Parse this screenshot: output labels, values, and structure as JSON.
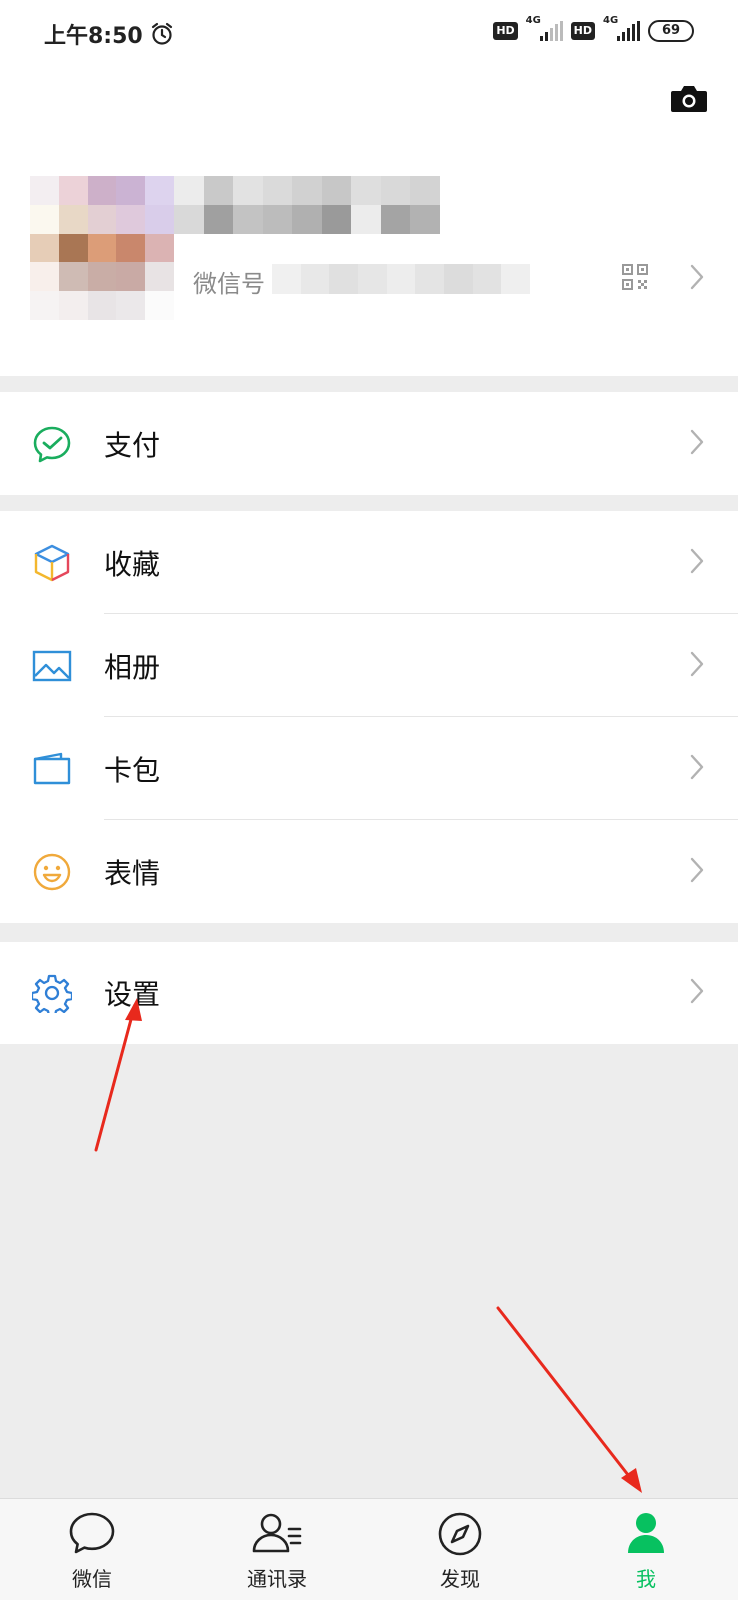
{
  "status_bar": {
    "time": "上午8:50",
    "hd_1": "HD",
    "net_1": "4G",
    "hd_2": "HD",
    "net_2": "4G",
    "battery": "69"
  },
  "profile": {
    "wechat_id_label": "微信号"
  },
  "menu_groups": [
    {
      "items": [
        {
          "label": "支付",
          "icon": "wechat-pay-icon"
        }
      ]
    },
    {
      "items": [
        {
          "label": "收藏",
          "icon": "favorites-cube-icon"
        },
        {
          "label": "相册",
          "icon": "album-icon"
        },
        {
          "label": "卡包",
          "icon": "card-wallet-icon"
        },
        {
          "label": "表情",
          "icon": "sticker-smile-icon"
        }
      ]
    },
    {
      "items": [
        {
          "label": "设置",
          "icon": "gear-icon"
        }
      ]
    }
  ],
  "tab_bar": {
    "tabs": [
      {
        "label": "微信",
        "icon": "chat-bubble-icon",
        "active": false
      },
      {
        "label": "通讯录",
        "icon": "contacts-icon",
        "active": false
      },
      {
        "label": "发现",
        "icon": "compass-icon",
        "active": false
      },
      {
        "label": "我",
        "icon": "me-person-icon",
        "active": true
      }
    ]
  },
  "colors": {
    "accent_green": "#07c160",
    "annotation_red": "#e8291d",
    "background": "#ededed"
  }
}
